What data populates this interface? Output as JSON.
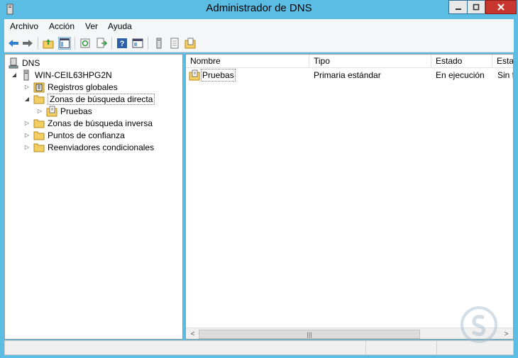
{
  "window": {
    "title": "Administrador de DNS"
  },
  "menu": {
    "items": [
      "Archivo",
      "Acción",
      "Ver",
      "Ayuda"
    ]
  },
  "toolbar": {
    "buttons": [
      "back-icon",
      "forward-icon",
      "up-folder-icon",
      "show-hide-tree-icon",
      "refresh-icon",
      "export-list-icon",
      "help-icon",
      "properties-icon",
      "server-icon",
      "document-icon",
      "zone-icon"
    ]
  },
  "tree": {
    "root": "DNS",
    "server": "WIN-CEIL63HPG2N",
    "items": [
      {
        "label": "Registros globales"
      },
      {
        "label": "Zonas de búsqueda directa",
        "children": [
          {
            "label": "Pruebas"
          }
        ]
      },
      {
        "label": "Zonas de búsqueda inversa"
      },
      {
        "label": "Puntos de confianza"
      },
      {
        "label": "Reenviadores condicionales"
      }
    ]
  },
  "list": {
    "columns": [
      "Nombre",
      "Tipo",
      "Estado",
      "Estad"
    ],
    "rows": [
      {
        "nombre": "Pruebas",
        "tipo": "Primaria estándar",
        "estado": "En ejecución",
        "estado2": "Sin fi"
      }
    ]
  },
  "colors": {
    "titlebar": "#5bbde4",
    "close": "#c7372f",
    "folder": "#f3cf63"
  }
}
